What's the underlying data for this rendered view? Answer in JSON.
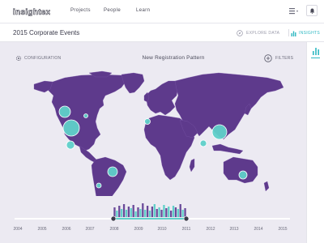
{
  "app": {
    "logo_text": "insightex"
  },
  "nav": {
    "items": [
      {
        "label": "Projects"
      },
      {
        "label": "People"
      },
      {
        "label": "Learn"
      }
    ]
  },
  "header": {
    "title": "2015 Corporate Events",
    "explore_label": "EXPLORE DATA",
    "insights_label": "INSIGHTS"
  },
  "map": {
    "config_label": "CONFIGURATION",
    "title": "New Registration Pattern",
    "filters_label": "FILTERS",
    "land_color": "#5e3a8c",
    "bubble_color": "#5fd0c9",
    "background_color": "#eceaf2"
  },
  "timeline": {
    "ticks": [
      "2004",
      "2005",
      "2006",
      "2007",
      "2008",
      "2009",
      "2010",
      "2011",
      "2012",
      "2013",
      "2014",
      "2015"
    ],
    "selected_start": "2008",
    "selected_end": "2011",
    "bar_color": "#6a4a9a",
    "selected_bar_color": "#5fd0c9"
  },
  "accent_color": "#2eb8c2"
}
